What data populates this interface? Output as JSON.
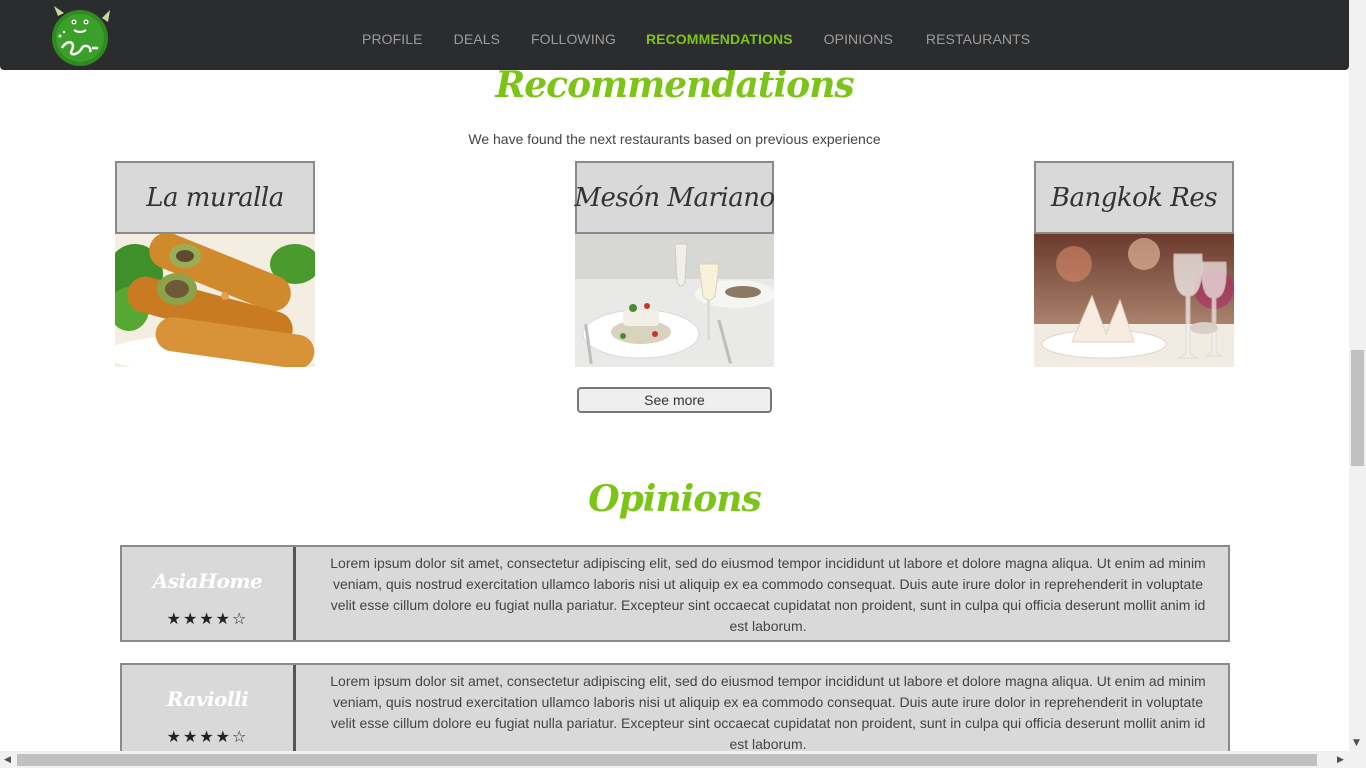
{
  "nav": {
    "items": [
      "PROFILE",
      "DEALS",
      "FOLLOWING",
      "RECOMMENDATIONS",
      "OPINIONS",
      "RESTAURANTS"
    ],
    "active": "RECOMMENDATIONS"
  },
  "recommendations": {
    "title": "Recommendations",
    "subtitle": "We have found the next restaurants based on previous experience",
    "restaurants": [
      {
        "name": "La muralla",
        "image": "spring-rolls-photo"
      },
      {
        "name": "Mesón Mariano",
        "image": "plated-dish-photo"
      },
      {
        "name": "Bangkok Res",
        "image": "table-setting-photo"
      }
    ],
    "see_more": "See more"
  },
  "opinions": {
    "title": "Opinions",
    "items": [
      {
        "name": "AsiaHome",
        "stars": "★★★★☆",
        "text": "Lorem ipsum dolor sit amet, consectetur adipiscing elit, sed do eiusmod tempor incididunt ut labore et dolore magna aliqua. Ut enim ad minim veniam, quis nostrud exercitation ullamco laboris nisi ut aliquip ex ea commodo consequat. Duis aute irure dolor in reprehenderit in voluptate velit esse cillum dolore eu fugiat nulla pariatur. Excepteur sint occaecat cupidatat non proident, sunt in culpa qui officia deserunt mollit anim id est laborum."
      },
      {
        "name": "Raviolli",
        "stars": "★★★★☆",
        "text": "Lorem ipsum dolor sit amet, consectetur adipiscing elit, sed do eiusmod tempor incididunt ut labore et dolore magna aliqua. Ut enim ad minim veniam, quis nostrud exercitation ullamco laboris nisi ut aliquip ex ea commodo consequat. Duis aute irure dolor in reprehenderit in voluptate velit esse cillum dolore eu fugiat nulla pariatur. Excepteur sint occaecat cupidatat non proident, sunt in culpa qui officia deserunt mollit anim id est laborum."
      }
    ]
  },
  "colors": {
    "accent": "#7dc418",
    "nav_bg": "#2b2c2e",
    "card_bg": "#d9d9d9"
  }
}
